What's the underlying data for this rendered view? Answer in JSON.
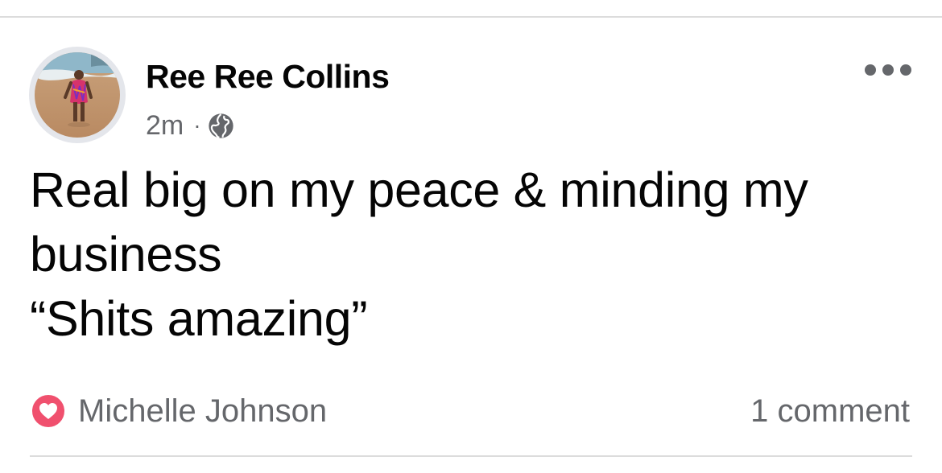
{
  "post": {
    "author_name": "Ree Ree Collins",
    "timestamp": "2m",
    "separator": "·",
    "audience_icon": "globe-icon",
    "more_icon": "more-horizontal-icon",
    "text_lines": [
      "Real big on my peace & minding my",
      "business",
      "“Shits amazing”"
    ]
  },
  "reactions": {
    "icon": "heart-reaction-icon",
    "reactor_name": "Michelle Johnson",
    "comment_count": "1 comment"
  },
  "colors": {
    "text_primary": "#050505",
    "text_secondary": "#65676b",
    "love_reaction": "#f0506e",
    "divider": "#dcdcdc"
  }
}
